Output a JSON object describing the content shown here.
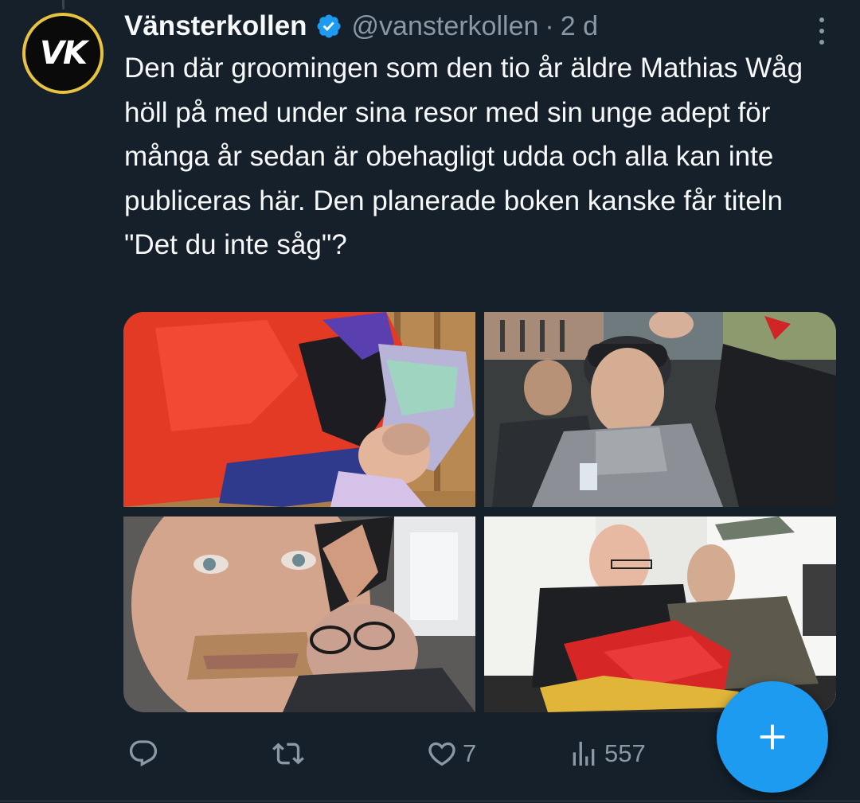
{
  "tweet": {
    "avatar_text": "VK",
    "author_name": "Vänsterkollen",
    "author_handle": "@vansterkollen",
    "separator": "·",
    "timestamp": "2 d",
    "text": "Den där groomingen som den tio år äldre Mathias Wåg höll på med under sina resor med sin unge adept för många år sedan är obehagligt udda och alla kan inte publiceras här. Den planerade boken kanske får titeln \"Det du inte såg\"?",
    "media_count": 4
  },
  "actions": {
    "reply_icon": "reply-icon",
    "retweet_icon": "retweet-icon",
    "like_icon": "heart-icon",
    "like_count": "7",
    "views_icon": "views-icon",
    "views_count": "557"
  },
  "fab": {
    "icon": "plus-icon"
  },
  "colors": {
    "background": "#15202b",
    "text_primary": "#f7f9f9",
    "text_secondary": "#8b98a5",
    "accent": "#1d9bf0",
    "avatar_border": "#e8c340"
  }
}
